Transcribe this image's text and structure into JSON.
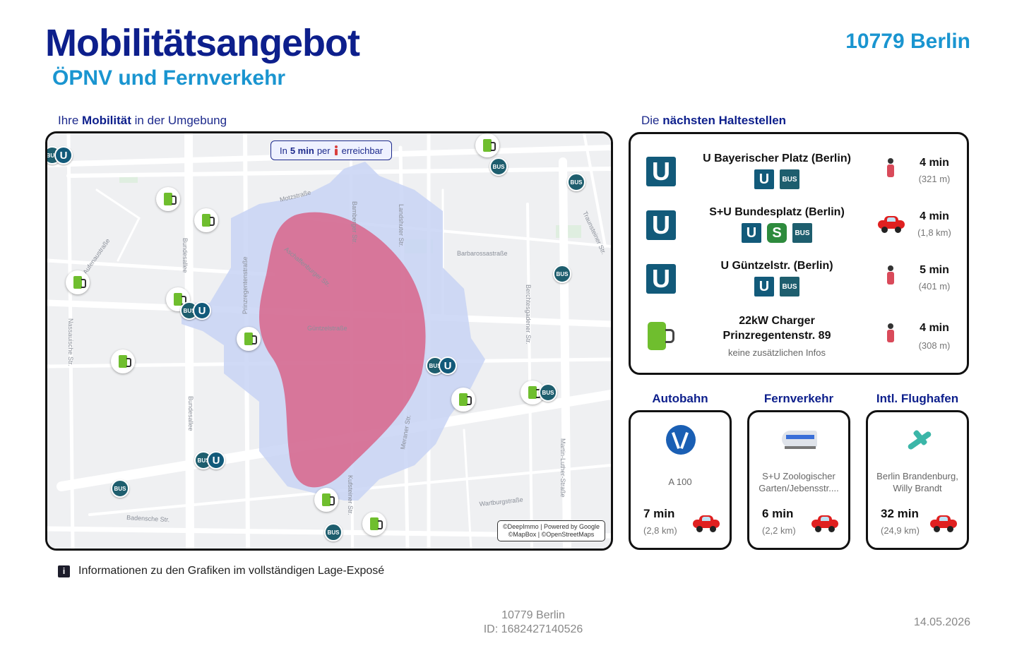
{
  "header": {
    "title": "Mobilitätsangebot",
    "subtitle": "ÖPNV und Fernverkehr",
    "location": "10779 Berlin"
  },
  "map_section": {
    "label_prefix": "Ihre",
    "label_bold": "Mobilität",
    "label_suffix": "in der Umgebung",
    "badge_prefix": "In",
    "badge_bold": "5 min",
    "badge_mid": "per",
    "badge_suffix": "erreichbar",
    "copyright_line1": "©DeepImmo | Powered by Google",
    "copyright_line2": "©MapBox | ©OpenStreetMaps",
    "street_labels": [
      "Motzstraße",
      "Barbarossastraße",
      "Aschaffenburger Str.",
      "Güntzelstraße",
      "Prinzregentenstraße",
      "Bundesallee",
      "Nassauische Str.",
      "Landshuter Str.",
      "Bamberger Str.",
      "Berchtesgadener Str.",
      "Traunsteiner Str.",
      "Martin-Luther-Straße",
      "Wartburgstraße",
      "Badensche Str.",
      "Kufsteiner Str.",
      "Meraner Str.",
      "Aufenaustraße",
      "Bundesallee"
    ]
  },
  "stops_section": {
    "label_prefix": "Die",
    "label_bold": "nächsten Haltestellen",
    "stops": [
      {
        "icon": "u-bahn-icon",
        "name": "U Bayerischer Platz (Berlin)",
        "lines": [
          "U",
          "BUS"
        ],
        "mode": "walk",
        "time": "4 min",
        "distance": "(321 m)"
      },
      {
        "icon": "u-bahn-icon",
        "name": "S+U Bundesplatz (Berlin)",
        "lines": [
          "U",
          "S",
          "BUS"
        ],
        "mode": "car",
        "time": "4 min",
        "distance": "(1,8 km)"
      },
      {
        "icon": "u-bahn-icon",
        "name": "U Güntzelstr. (Berlin)",
        "lines": [
          "U",
          "BUS"
        ],
        "mode": "walk",
        "time": "5 min",
        "distance": "(401 m)"
      },
      {
        "icon": "charger-icon",
        "name_line1": "22kW Charger",
        "name_line2": "Prinzregentenstr. 89",
        "info": "keine zusätzlichen Infos",
        "mode": "walk",
        "time": "4 min",
        "distance": "(308 m)"
      }
    ]
  },
  "cards": [
    {
      "label": "Autobahn",
      "icon": "highway-icon",
      "desc_line1": "A 100",
      "desc_line2": "",
      "time": "7 min",
      "distance": "(2,8 km)"
    },
    {
      "label": "Fernverkehr",
      "icon": "train-icon",
      "desc_line1": "S+U Zoologischer",
      "desc_line2": "Garten/Jebensstr....",
      "time": "6 min",
      "distance": "(2,2 km)"
    },
    {
      "label": "Intl. Flughafen",
      "icon": "airplane-icon",
      "desc_line1": "Berlin Brandenburg,",
      "desc_line2": "Willy Brandt",
      "time": "32 min",
      "distance": "(24,9 km)"
    }
  ],
  "note": "Informationen zu den Grafiken im vollständigen Lage-Exposé",
  "footer": {
    "line1": "10779 Berlin",
    "line2": "ID: 1682427140526",
    "date": "14.05.2026"
  },
  "colors": {
    "title": "#0d1f8c",
    "accent": "#1a95d0",
    "isochrone_walk": "#c8d4f4",
    "isochrone_core": "#d9557c",
    "u_bahn": "#125a7a",
    "s_bahn": "#2e8b3d"
  }
}
